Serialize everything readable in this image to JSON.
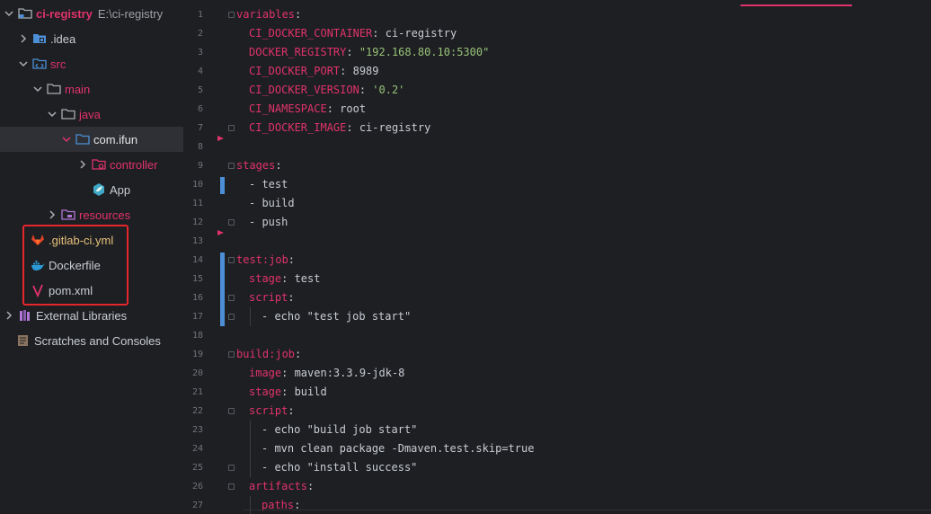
{
  "project": {
    "name": "ci-registry",
    "path": "E:\\ci-registry"
  },
  "tree": {
    "idea": ".idea",
    "src": "src",
    "main": "main",
    "java": "java",
    "package": "com.ifun",
    "controller": "controller",
    "app": "App",
    "resources": "resources",
    "gitlab_ci": ".gitlab-ci.yml",
    "dockerfile": "Dockerfile",
    "pom": "pom.xml",
    "external_libraries": "External Libraries",
    "scratches": "Scratches and Consoles"
  },
  "colors": {
    "accent": "#e0336b",
    "highlight_border": "#e5262c",
    "change_marker": "#4c8fd6",
    "string": "#98c379"
  },
  "code_lines": [
    {
      "n": "1"
    },
    {
      "n": "2"
    },
    {
      "n": "3"
    },
    {
      "n": "4"
    },
    {
      "n": "5"
    },
    {
      "n": "6"
    },
    {
      "n": "7"
    },
    {
      "n": "8"
    },
    {
      "n": "9"
    },
    {
      "n": "10"
    },
    {
      "n": "11"
    },
    {
      "n": "12"
    },
    {
      "n": "13"
    },
    {
      "n": "14"
    },
    {
      "n": "15"
    },
    {
      "n": "16"
    },
    {
      "n": "17"
    },
    {
      "n": "18"
    },
    {
      "n": "19"
    },
    {
      "n": "20"
    },
    {
      "n": "21"
    },
    {
      "n": "22"
    },
    {
      "n": "23"
    },
    {
      "n": "24"
    },
    {
      "n": "25"
    },
    {
      "n": "26"
    },
    {
      "n": "27"
    }
  ],
  "code": {
    "l1_key": "variables",
    "l2_key": "CI_DOCKER_CONTAINER",
    "l2_val": "ci-registry",
    "l3_key": "DOCKER_REGISTRY",
    "l3_val": "\"192.168.80.10:5300\"",
    "l4_key": "CI_DOCKER_PORT",
    "l4_val": "8989",
    "l5_key": "CI_DOCKER_VERSION",
    "l5_val": "'0.2'",
    "l6_key": "CI_NAMESPACE",
    "l6_val": "root",
    "l7_key": "CI_DOCKER_IMAGE",
    "l7_val": "ci-registry",
    "l9_key": "stages",
    "l10_val": "test",
    "l11_val": "build",
    "l12_val": "push",
    "l14_key": "test:job",
    "l15_key": "stage",
    "l15_val": "test",
    "l16_key": "script",
    "l17_val": "echo \"test job start\"",
    "l19_key": "build:job",
    "l20_key": "image",
    "l20_val": "maven:3.3.9-jdk-8",
    "l21_key": "stage",
    "l21_val": "build",
    "l22_key": "script",
    "l23_val": "echo \"build job start\"",
    "l24_val": "mvn clean package -Dmaven.test.skip=true",
    "l25_val": "echo \"install success\"",
    "l26_key": "artifacts",
    "l27_key": "paths"
  }
}
